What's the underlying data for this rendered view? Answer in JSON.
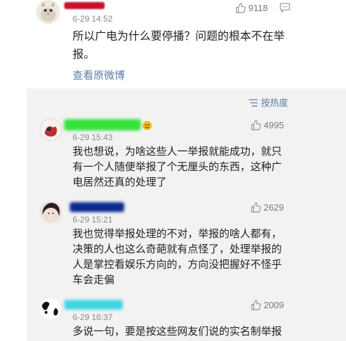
{
  "top_comment": {
    "time": "6-29 14:52",
    "likes": "9118",
    "text_lines": [
      "所以广电为什么要停播？问题的根本不在举",
      "报。"
    ],
    "view_original": "查看原微博"
  },
  "replies_section": {
    "sort_label": "按热度"
  },
  "replies": [
    {
      "time": "6-29 15:43",
      "likes": "4995",
      "text_lines": [
        "我也想说，为啥这些人一举报就能成功，就只",
        "有一个人随便举报了个无厘头的东西，这种广",
        "电居然还真的处理了"
      ]
    },
    {
      "time": "6-29 15:21",
      "likes": "2629",
      "text_lines": [
        "我也觉得举报处理的不对，举报的啥人都有，",
        "决策的人也这么奇葩就有点怪了，处理举报的",
        "人是掌控看娱乐方向的，方向没把握好不怪乎",
        "车会走偏"
      ]
    },
    {
      "time": "6-29 16:37",
      "likes": "2009",
      "text_lines": [
        "多说一句，要是按这些网友们说的实名制举报"
      ]
    }
  ],
  "colors": {
    "link": "#5b7ca6",
    "panel_bg": "#f2f2f2",
    "redact_red": "#c8102e",
    "redact_green": "#33e23a",
    "redact_navy": "#0b2a8f",
    "redact_cyan": "#3fd6e3"
  }
}
